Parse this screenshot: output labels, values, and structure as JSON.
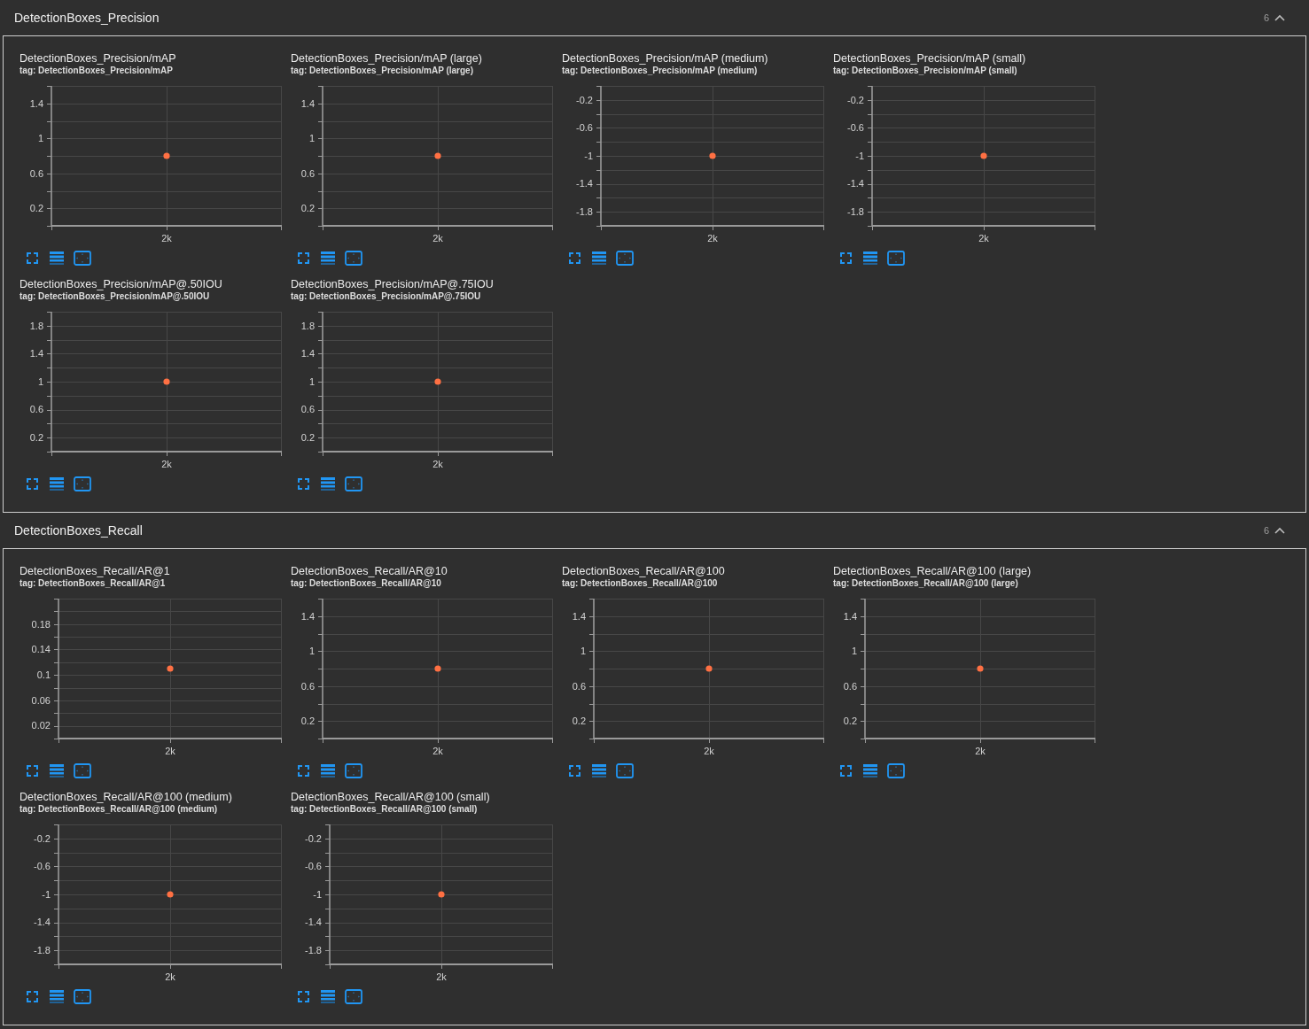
{
  "sections": [
    {
      "title": "DetectionBoxes_Precision",
      "count": "6",
      "expanded": true,
      "cards": [
        {
          "title": "DetectionBoxes_Precision/mAP",
          "tag": "tag: DetectionBoxes_Precision/mAP",
          "chart_data": {
            "type": "scatter",
            "categories": [
              "2k"
            ],
            "values": [
              0.8
            ],
            "ylim": [
              0,
              1.6
            ],
            "yticks": [
              0.2,
              0.6,
              1,
              1.4
            ],
            "grid": true
          }
        },
        {
          "title": "DetectionBoxes_Precision/mAP (large)",
          "tag": "tag: DetectionBoxes_Precision/mAP (large)",
          "chart_data": {
            "type": "scatter",
            "categories": [
              "2k"
            ],
            "values": [
              0.8
            ],
            "ylim": [
              0,
              1.6
            ],
            "yticks": [
              0.2,
              0.6,
              1,
              1.4
            ],
            "grid": true
          }
        },
        {
          "title": "DetectionBoxes_Precision/mAP (medium)",
          "tag": "tag: DetectionBoxes_Precision/mAP (medium)",
          "chart_data": {
            "type": "scatter",
            "categories": [
              "2k"
            ],
            "values": [
              -1
            ],
            "ylim": [
              -2,
              0
            ],
            "yticks": [
              -1.8,
              -1.4,
              -1,
              -0.6,
              -0.2
            ],
            "grid": true
          }
        },
        {
          "title": "DetectionBoxes_Precision/mAP (small)",
          "tag": "tag: DetectionBoxes_Precision/mAP (small)",
          "chart_data": {
            "type": "scatter",
            "categories": [
              "2k"
            ],
            "values": [
              -1
            ],
            "ylim": [
              -2,
              0
            ],
            "yticks": [
              -1.8,
              -1.4,
              -1,
              -0.6,
              -0.2
            ],
            "grid": true
          }
        },
        {
          "title": "DetectionBoxes_Precision/mAP@.50IOU",
          "tag": "tag: DetectionBoxes_Precision/mAP@.50IOU",
          "chart_data": {
            "type": "scatter",
            "categories": [
              "2k"
            ],
            "values": [
              1
            ],
            "ylim": [
              0,
              2
            ],
            "yticks": [
              0.2,
              0.6,
              1,
              1.4,
              1.8
            ],
            "grid": true
          }
        },
        {
          "title": "DetectionBoxes_Precision/mAP@.75IOU",
          "tag": "tag: DetectionBoxes_Precision/mAP@.75IOU",
          "chart_data": {
            "type": "scatter",
            "categories": [
              "2k"
            ],
            "values": [
              1
            ],
            "ylim": [
              0,
              2
            ],
            "yticks": [
              0.2,
              0.6,
              1,
              1.4,
              1.8
            ],
            "grid": true
          }
        }
      ]
    },
    {
      "title": "DetectionBoxes_Recall",
      "count": "6",
      "expanded": true,
      "cards": [
        {
          "title": "DetectionBoxes_Recall/AR@1",
          "tag": "tag: DetectionBoxes_Recall/AR@1",
          "chart_data": {
            "type": "scatter",
            "categories": [
              "2k"
            ],
            "values": [
              0.11
            ],
            "ylim": [
              0,
              0.22
            ],
            "yticks": [
              0.02,
              0.06,
              0.1,
              0.14,
              0.18
            ],
            "grid": true
          }
        },
        {
          "title": "DetectionBoxes_Recall/AR@10",
          "tag": "tag: DetectionBoxes_Recall/AR@10",
          "chart_data": {
            "type": "scatter",
            "categories": [
              "2k"
            ],
            "values": [
              0.8
            ],
            "ylim": [
              0,
              1.6
            ],
            "yticks": [
              0.2,
              0.6,
              1,
              1.4
            ],
            "grid": true
          }
        },
        {
          "title": "DetectionBoxes_Recall/AR@100",
          "tag": "tag: DetectionBoxes_Recall/AR@100",
          "chart_data": {
            "type": "scatter",
            "categories": [
              "2k"
            ],
            "values": [
              0.8
            ],
            "ylim": [
              0,
              1.6
            ],
            "yticks": [
              0.2,
              0.6,
              1,
              1.4
            ],
            "grid": true
          }
        },
        {
          "title": "DetectionBoxes_Recall/AR@100 (large)",
          "tag": "tag: DetectionBoxes_Recall/AR@100 (large)",
          "chart_data": {
            "type": "scatter",
            "categories": [
              "2k"
            ],
            "values": [
              0.8
            ],
            "ylim": [
              0,
              1.6
            ],
            "yticks": [
              0.2,
              0.6,
              1,
              1.4
            ],
            "grid": true
          }
        },
        {
          "title": "DetectionBoxes_Recall/AR@100 (medium)",
          "tag": "tag: DetectionBoxes_Recall/AR@100 (medium)",
          "chart_data": {
            "type": "scatter",
            "categories": [
              "2k"
            ],
            "values": [
              -1
            ],
            "ylim": [
              -2,
              0
            ],
            "yticks": [
              -1.8,
              -1.4,
              -1,
              -0.6,
              -0.2
            ],
            "grid": true
          }
        },
        {
          "title": "DetectionBoxes_Recall/AR@100 (small)",
          "tag": "tag: DetectionBoxes_Recall/AR@100 (small)",
          "chart_data": {
            "type": "scatter",
            "categories": [
              "2k"
            ],
            "values": [
              -1
            ],
            "ylim": [
              -2,
              0
            ],
            "yticks": [
              -1.8,
              -1.4,
              -1,
              -0.6,
              -0.2
            ],
            "grid": true
          }
        }
      ]
    }
  ]
}
